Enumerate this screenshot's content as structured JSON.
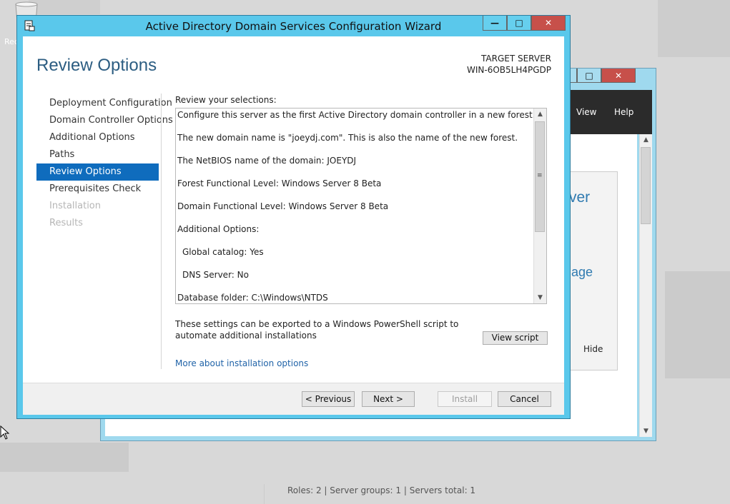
{
  "desktop": {
    "recycle_label": "Rec"
  },
  "background_window": {
    "menu": {
      "view": "View",
      "help": "Help"
    },
    "card_text_1": "rver",
    "card_text_2": "nage",
    "hide_label": "Hide",
    "status": "Roles: 2  |  Server groups: 1  |  Servers total: 1"
  },
  "wizard": {
    "title": "Active Directory Domain Services Configuration Wizard",
    "page_heading": "Review Options",
    "target_label": "TARGET SERVER",
    "target_name": "WIN-6OB5LH4PGDP",
    "nav": [
      {
        "label": "Deployment Configuration",
        "state": "normal"
      },
      {
        "label": "Domain Controller Options",
        "state": "normal"
      },
      {
        "label": "Additional Options",
        "state": "normal"
      },
      {
        "label": "Paths",
        "state": "normal"
      },
      {
        "label": "Review Options",
        "state": "active"
      },
      {
        "label": "Prerequisites Check",
        "state": "normal"
      },
      {
        "label": "Installation",
        "state": "disabled"
      },
      {
        "label": "Results",
        "state": "disabled"
      }
    ],
    "review_label": "Review your selections:",
    "review_lines": [
      "Configure this server as the first Active Directory domain controller in a new forest.",
      "The new domain name is \"joeydj.com\". This is also the name of the new forest.",
      "The NetBIOS name of the domain: JOEYDJ",
      "Forest Functional Level: Windows Server 8 Beta",
      "Domain Functional Level: Windows Server 8 Beta",
      "Additional Options:",
      "Global catalog: Yes",
      "DNS Server: No",
      "Database folder: C:\\Windows\\NTDS"
    ],
    "export_text": "These settings can be exported to a Windows PowerShell script to automate additional installations",
    "view_script": "View script",
    "more_link": "More about installation options",
    "buttons": {
      "previous": "< Previous",
      "next": "Next >",
      "install": "Install",
      "cancel": "Cancel"
    }
  },
  "colors": {
    "title_bar": "#5ac8eb",
    "nav_active": "#0f6cbd",
    "heading": "#2c5d82",
    "close_button": "#c7504a"
  }
}
